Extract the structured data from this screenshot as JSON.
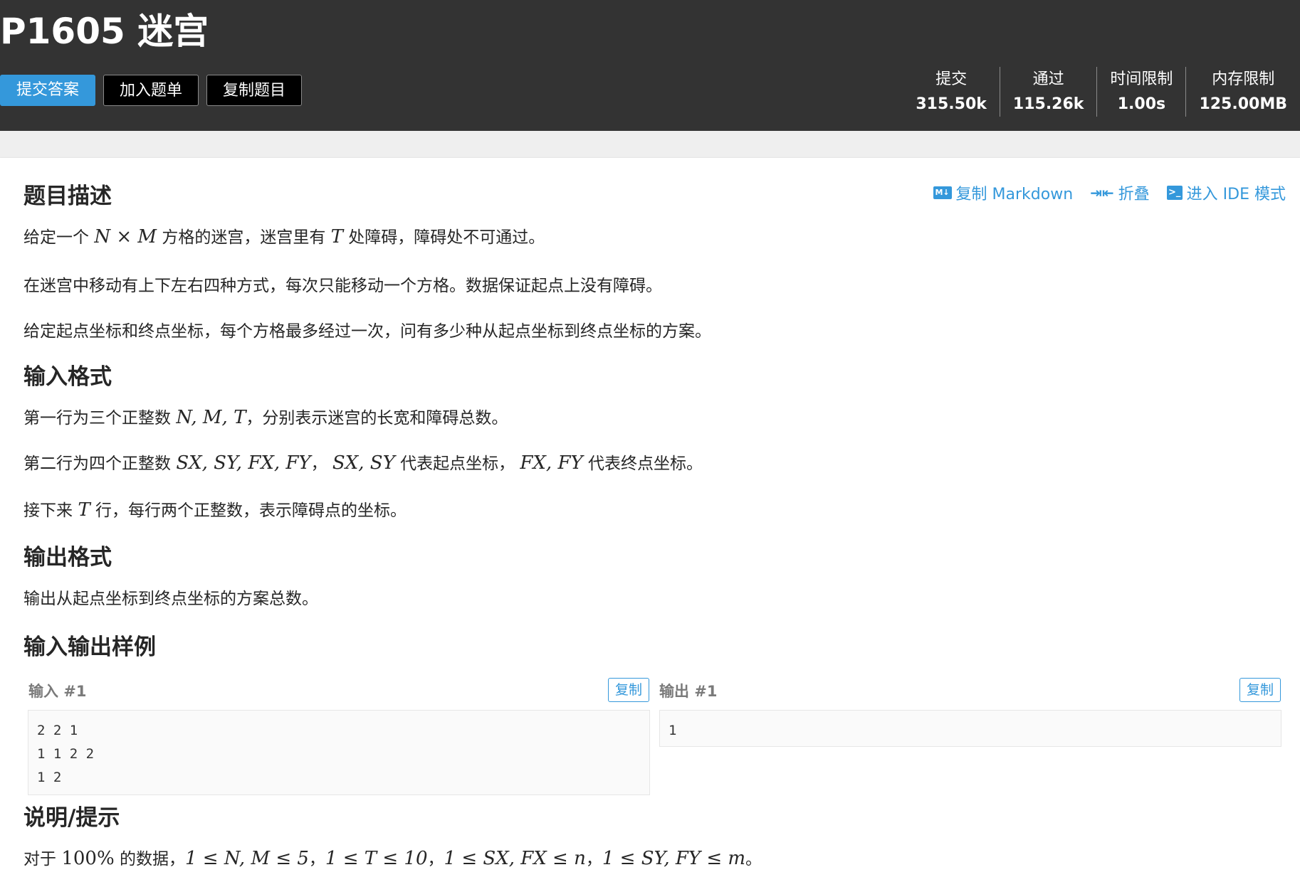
{
  "header": {
    "title": "P1605 迷宫",
    "submit_label": "提交答案",
    "add_list_label": "加入题单",
    "copy_problem_label": "复制题目",
    "stats": [
      {
        "label": "提交",
        "value": "315.50k"
      },
      {
        "label": "通过",
        "value": "115.26k"
      },
      {
        "label": "时间限制",
        "value": "1.00s"
      },
      {
        "label": "内存限制",
        "value": "125.00MB"
      }
    ]
  },
  "toolbar": {
    "copy_md_label": "复制 Markdown",
    "fold_label": "折叠",
    "ide_label": "进入 IDE 模式",
    "md_icon_text": "M↓",
    "ide_icon_text": ">_"
  },
  "sections": {
    "description_title": "题目描述",
    "input_title": "输入格式",
    "output_title": "输出格式",
    "samples_title": "输入输出样例",
    "hint_title": "说明/提示"
  },
  "description": {
    "p1_a": "给定一个",
    "p1_math": "N × M",
    "p1_b": "方格的迷宫，迷宫里有",
    "p1_math2": "T",
    "p1_c": "处障碍，障碍处不可通过。",
    "p2": "在迷宫中移动有上下左右四种方式，每次只能移动一个方格。数据保证起点上没有障碍。",
    "p3": "给定起点坐标和终点坐标，每个方格最多经过一次，问有多少种从起点坐标到终点坐标的方案。"
  },
  "input_format": {
    "l1_a": "第一行为三个正整数",
    "l1_math": "N, M, T",
    "l1_b": "，分别表示迷宫的长宽和障碍总数。",
    "l2_a": "第二行为四个正整数",
    "l2_math": "SX, SY, FX, FY",
    "l2_b": "，",
    "l2_math2": "SX, SY",
    "l2_c": "代表起点坐标，",
    "l2_math3": "FX, FY",
    "l2_d": "代表终点坐标。",
    "l3_a": "接下来",
    "l3_math": "T",
    "l3_b": "行，每行两个正整数，表示障碍点的坐标。"
  },
  "output_format": {
    "text": "输出从起点坐标到终点坐标的方案总数。"
  },
  "samples": {
    "input_label": "输入 #1",
    "output_label": "输出 #1",
    "copy_label": "复制",
    "input_text": "2 2 1\n1 1 2 2\n1 2",
    "output_text": "1"
  },
  "hint": {
    "a": "对于",
    "pct": "100%",
    "b": "的数据，",
    "m1": "1 ≤ N, M ≤ 5",
    "c": "，",
    "m2": "1 ≤ T ≤ 10",
    "d": "，",
    "m3": "1 ≤ SX, FX ≤ n",
    "e": "，",
    "m4": "1 ≤ SY, FY ≤ m",
    "f": "。"
  }
}
